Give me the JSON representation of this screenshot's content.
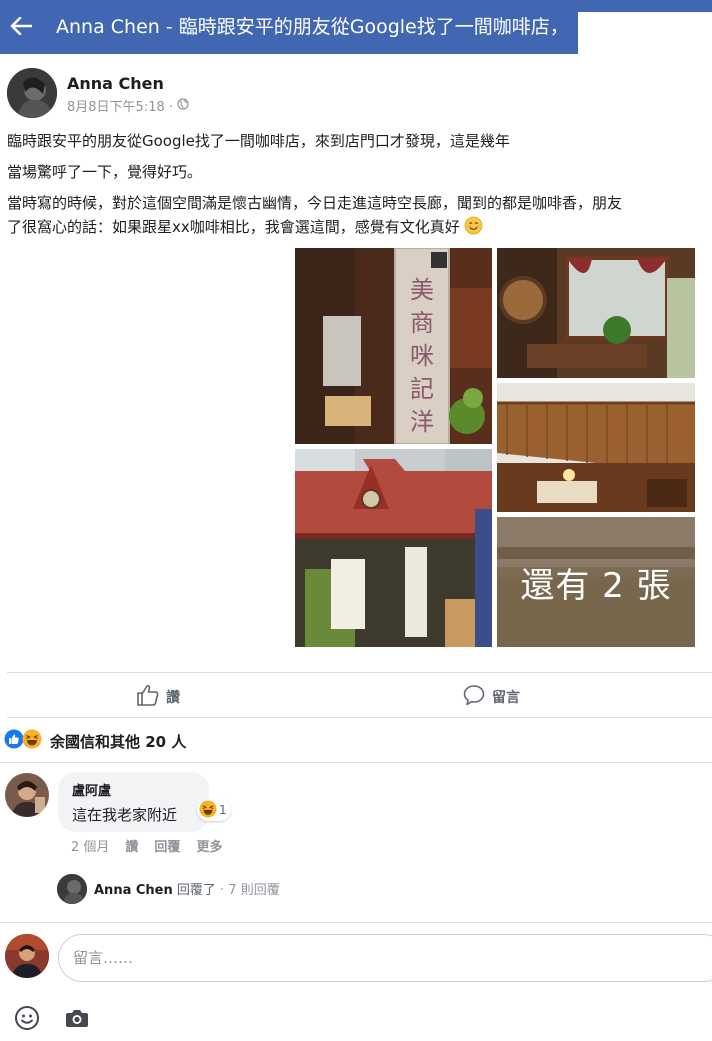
{
  "header": {
    "title": "Anna Chen - 臨時跟安平的朋友從Google找了一間咖啡店，"
  },
  "post": {
    "author": "Anna Chen",
    "date": "8月8日下午5:18 ·",
    "privacy_icon": "globe-icon",
    "lines": [
      "臨時跟安平的朋友從Google找了一間咖啡店，來到店門口才發現，這是幾年",
      "當場驚呼了一下，覺得好巧。",
      "當時寫的時候，對於這個空間滿是懷古幽情，今日走進這時空長廊，聞到的都是咖啡香，朋友",
      "了很窩心的話：如果跟星xx咖啡相比，我會選這間，感覺有文化真好"
    ],
    "sign_chars": [
      "美",
      "商",
      "咪",
      "記",
      "洋"
    ],
    "more_photos": "還有 2 張"
  },
  "actions": {
    "like": "讚",
    "comment": "留言"
  },
  "reactions": {
    "summary": "余國信和其他 20 人"
  },
  "comment": {
    "author": "盧阿盧",
    "text": "這在我老家附近",
    "reaction_count": "1",
    "time": "2 個月",
    "like": "讚",
    "reply": "回覆",
    "more": "更多"
  },
  "reply_preview": {
    "author": "Anna Chen",
    "action": "回覆了",
    "count": "· 7 則回覆"
  },
  "composer": {
    "placeholder": "留言……"
  },
  "colors": {
    "brand": "#4267b2",
    "text": "#1c1e21",
    "muted": "#90949c"
  }
}
